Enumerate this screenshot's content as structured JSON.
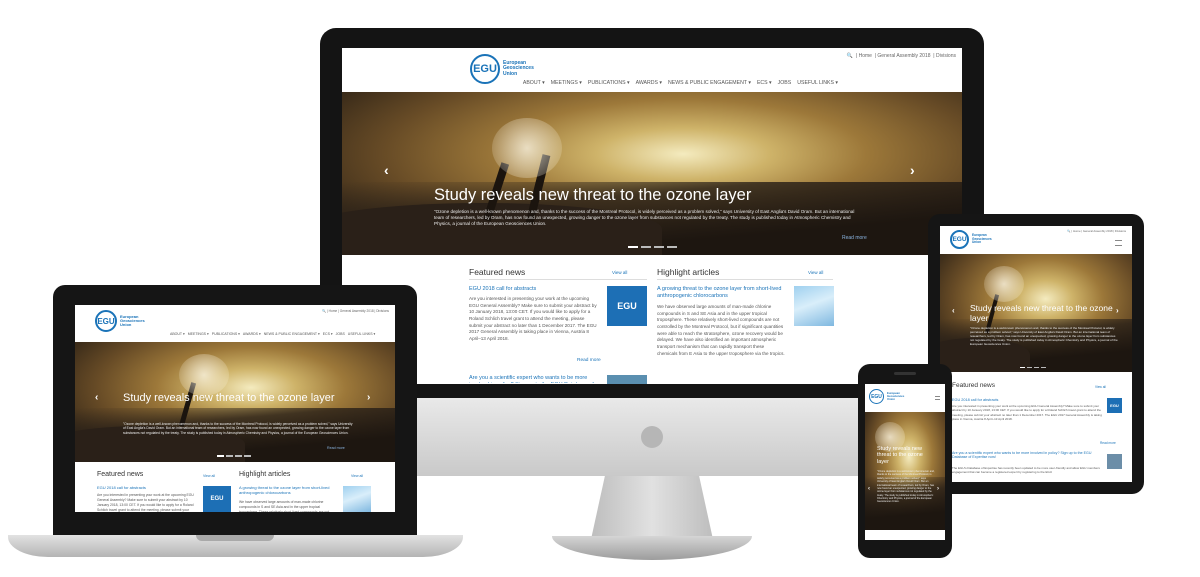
{
  "site": {
    "logo_mark": "EGU",
    "logo_name": "European Geosciences Union",
    "topbar": [
      "🔍",
      "Home",
      "General Assembly 2018",
      "Divisions"
    ],
    "nav": [
      "ABOUT ▾",
      "MEETINGS ▾",
      "PUBLICATIONS ▾",
      "AWARDS ▾",
      "NEWS & PUBLIC ENGAGEMENT ▾",
      "ECS ▾",
      "JOBS",
      "USEFUL LINKS ▾"
    ],
    "hero": {
      "title": "Study reveals new threat to the ozone layer",
      "text": "\"Ozone depletion is a well-known phenomenon and, thanks to the success of the Montreal Protocol, is widely perceived as a problem solved,\" says University of East Anglia's David Oram. But an international team of researchers, led by Oram, has now found an unexpected, growing danger to the ozone layer from substances not regulated by the treaty. The study is published today in Atmospheric Chemistry and Physics, a journal of the European Geosciences Union.",
      "read_more": "Read more",
      "prev_arrow": "‹",
      "next_arrow": "›"
    },
    "featured": {
      "heading": "Featured news",
      "view_all": "View all",
      "item1_title": "EGU 2018 call for abstracts",
      "item1_text": "Are you interested in presenting your work at the upcoming EGU General Assembly? Make sure to submit your abstract by 10 January 2018, 13:00 CET. If you would like to apply for a Roland Schlich travel grant to attend the meeting, please submit your abstract no later than 1 December 2017. The EGU 2017 General Assembly is taking place in Vienna, Austria 8 April–13 April 2018.",
      "read_more": "Read more",
      "item2_title": "Are you a scientific expert who wants to be more involved in policy? Sign up to the EGU Database of Expertise now!",
      "item2_text": "The EGU's Database of Expertise has recently been updated to be more user-friendly and allow EGU members engagement that can become a registered expert by registering to the EGU"
    },
    "highlight": {
      "heading": "Highlight articles",
      "view_all": "View all",
      "item1_title": "A growing threat to the ozone layer from short-lived anthropogenic chlorocarbons",
      "item1_text": "We have observed large amounts of man-made chlorine compounds in S and SE Asia and in the upper tropical troposphere. These relatively short-lived compounds are not controlled by the Montreal Protocol, but if significant quantities were able to reach the stratosphere, ozone recovery would be delayed. We have also identified an important atmospheric transport mechanism that can rapidly transport these chemicals from E Asia to the upper troposphere via the tropics."
    }
  },
  "colors": {
    "brand_blue": "#1a73b8",
    "device_black": "#111111",
    "bezel_dark": "#1c1c1c",
    "aluminium": "#c8c8c8"
  }
}
